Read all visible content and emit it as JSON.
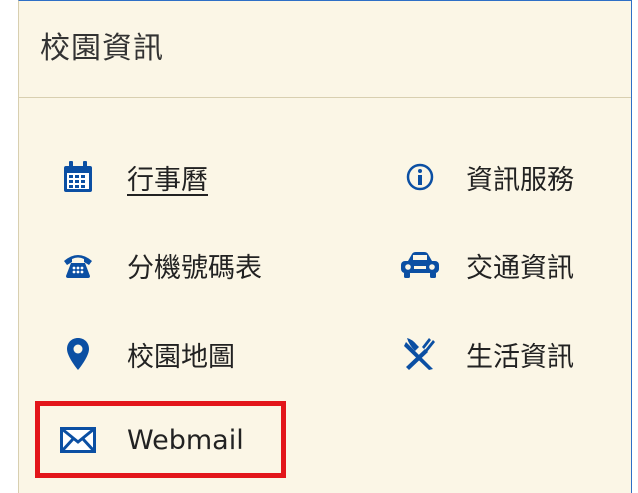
{
  "panel": {
    "title": "校園資訊"
  },
  "links": [
    {
      "label": "行事曆",
      "icon": "calendar-icon"
    },
    {
      "label": "資訊服務",
      "icon": "info-circle-icon"
    },
    {
      "label": "分機號碼表",
      "icon": "telephone-icon"
    },
    {
      "label": "交通資訊",
      "icon": "car-icon"
    },
    {
      "label": "校園地圖",
      "icon": "map-marker-icon"
    },
    {
      "label": "生活資訊",
      "icon": "fork-knife-icon"
    },
    {
      "label": "Webmail",
      "icon": "envelope-icon"
    }
  ],
  "colors": {
    "icon": "#0b4fa3",
    "panel_bg": "#fbf6e6",
    "highlight": "#e3161b"
  }
}
